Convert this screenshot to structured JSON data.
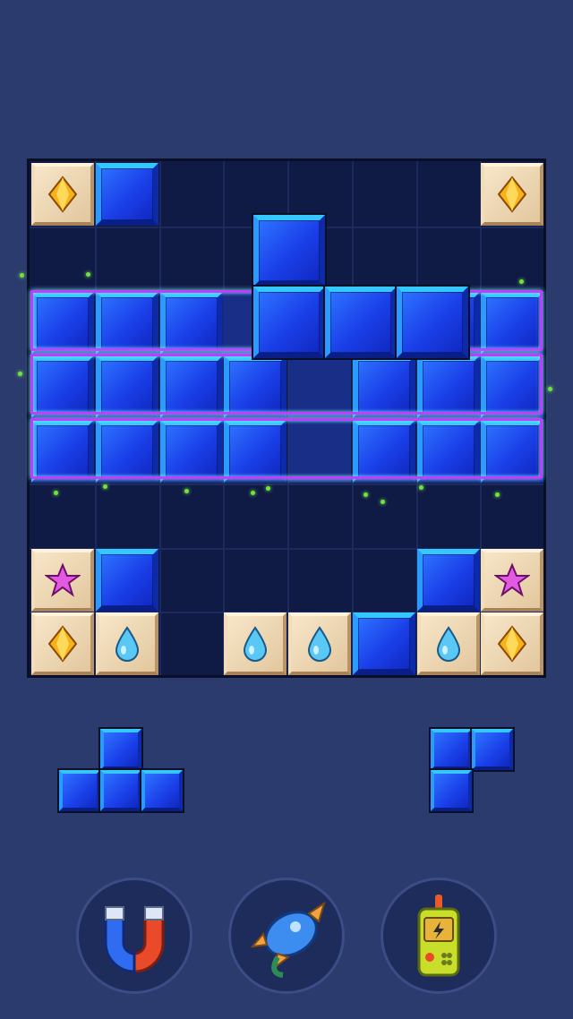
{
  "board": {
    "size": 8,
    "cells": [
      [
        "diamond",
        "blue",
        "empty",
        "empty",
        "empty",
        "empty",
        "empty",
        "diamond"
      ],
      [
        "empty",
        "empty",
        "empty",
        "empty",
        "empty",
        "empty",
        "empty",
        "empty"
      ],
      [
        "blue",
        "blue",
        "blue",
        "ghost",
        "ghost",
        "blue",
        "blue",
        "blue"
      ],
      [
        "blue",
        "blue",
        "blue",
        "blue",
        "ghost",
        "blue",
        "blue",
        "blue"
      ],
      [
        "blue",
        "blue",
        "blue",
        "blue",
        "ghost",
        "blue",
        "blue",
        "blue"
      ],
      [
        "empty",
        "empty",
        "empty",
        "empty",
        "empty",
        "empty",
        "empty",
        "empty"
      ],
      [
        "star",
        "blue",
        "empty",
        "empty",
        "empty",
        "empty",
        "blue",
        "star"
      ],
      [
        "diamond",
        "drop",
        "empty",
        "drop",
        "drop",
        "blue",
        "drop",
        "diamond"
      ]
    ],
    "highlighted_rows": [
      2,
      3,
      4
    ]
  },
  "dragging_piece": {
    "shape": "Z-tetromino-vertical",
    "cells": [
      [
        0,
        0
      ],
      [
        0,
        1
      ],
      [
        1,
        1
      ],
      [
        2,
        1
      ]
    ]
  },
  "tray": {
    "pieces": [
      {
        "name": "T-piece",
        "cells": [
          [
            1,
            0
          ],
          [
            0,
            1
          ],
          [
            1,
            1
          ],
          [
            2,
            1
          ]
        ]
      },
      {
        "name": "corner-piece",
        "cells": [
          [
            0,
            0
          ],
          [
            1,
            0
          ],
          [
            0,
            1
          ]
        ]
      }
    ]
  },
  "tools": [
    {
      "name": "magnet",
      "icon": "magnet-icon"
    },
    {
      "name": "rocket",
      "icon": "rocket-icon"
    },
    {
      "name": "walkie-talkie",
      "icon": "walkie-talkie-icon"
    }
  ],
  "colors": {
    "background": "#2b3b6e",
    "board": "#0f1a45",
    "block_blue": "#1a3fe8",
    "highlight": "#c13cff"
  }
}
